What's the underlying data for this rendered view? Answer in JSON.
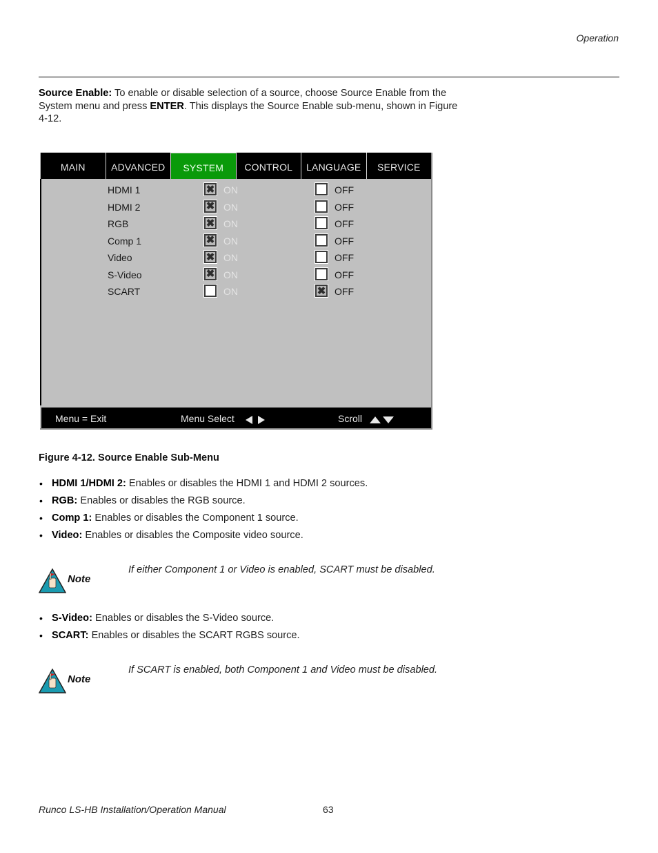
{
  "header": {
    "section": "Operation"
  },
  "intro": {
    "term": "Source Enable:",
    "text_1": " To enable or disable selection of a source, choose Source Enable from the System menu and press ",
    "key": "ENTER",
    "text_2": ". This displays the Source Enable sub-menu, shown in Figure 4-12."
  },
  "osd": {
    "tabs": [
      {
        "label": "MAIN",
        "active": false
      },
      {
        "label": "ADVANCED",
        "active": false
      },
      {
        "label": "SYSTEM",
        "active": true
      },
      {
        "label": "CONTROL",
        "active": false
      },
      {
        "label": "LANGUAGE",
        "active": false
      },
      {
        "label": "SERVICE",
        "active": false
      }
    ],
    "on_label": "ON",
    "off_label": "OFF",
    "check_glyph": "✖",
    "sources": [
      {
        "name": "HDMI 1",
        "on": true
      },
      {
        "name": "HDMI 2",
        "on": true
      },
      {
        "name": "RGB",
        "on": true
      },
      {
        "name": "Comp 1",
        "on": true
      },
      {
        "name": "Video",
        "on": true
      },
      {
        "name": "S-Video",
        "on": true
      },
      {
        "name": "SCART",
        "on": false
      }
    ],
    "footer": {
      "exit": "Menu = Exit",
      "select": "Menu Select",
      "scroll": "Scroll"
    },
    "colors": {
      "active_tab": "#0a9a0a",
      "panel": "#c0c0c0",
      "bar": "#000000"
    }
  },
  "caption": "Figure 4-12. Source Enable Sub-Menu",
  "bullets_1": [
    {
      "term": "HDMI 1/HDMI 2:",
      "text": " Enables or disables the HDMI 1 and HDMI 2 sources."
    },
    {
      "term": "RGB:",
      "text": " Enables or disables the RGB source."
    },
    {
      "term": "Comp 1:",
      "text": " Enables or disables the Component 1 source."
    },
    {
      "term": "Video:",
      "text": " Enables or disables the Composite video source."
    }
  ],
  "note_1": {
    "label": "Note",
    "text": "If either Component 1 or Video is enabled, SCART must be disabled."
  },
  "bullets_2": [
    {
      "term": "S-Video:",
      "text": " Enables or disables the S-Video source."
    },
    {
      "term": "SCART:",
      "text": " Enables or disables the SCART RGBS source."
    }
  ],
  "note_2": {
    "label": "Note",
    "text": "If SCART is enabled, both Component 1 and Video must be disabled."
  },
  "footer": {
    "manual": "Runco LS-HB Installation/Operation Manual",
    "page": "63"
  }
}
